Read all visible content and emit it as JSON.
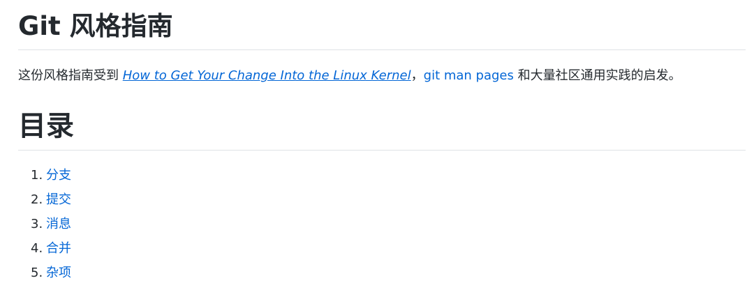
{
  "heading": {
    "title": "Git 风格指南"
  },
  "intro": {
    "prefix": "这份风格指南受到 ",
    "link1": "How to Get Your Change Into the Linux Kernel",
    "separator": "，",
    "link2": "git man pages",
    "suffix": " 和大量社区通用实践的启发。"
  },
  "toc": {
    "title": "目录",
    "items": [
      {
        "number": "1.",
        "label": "分支"
      },
      {
        "number": "2.",
        "label": "提交"
      },
      {
        "number": "3.",
        "label": "消息"
      },
      {
        "number": "4.",
        "label": "合并"
      },
      {
        "number": "5.",
        "label": "杂项"
      }
    ]
  },
  "colors": {
    "text": "#24292e",
    "link": "#0366d6",
    "divider": "#dfe2e5"
  }
}
